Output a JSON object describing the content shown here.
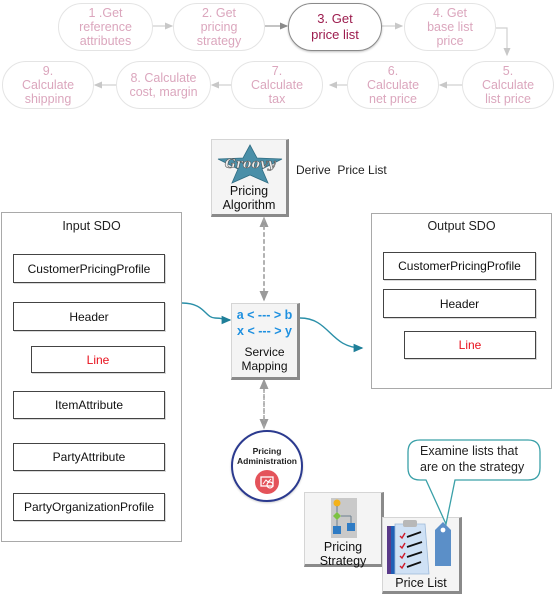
{
  "process_steps": [
    {
      "id": 1,
      "label": "1 .Get\nreference\nattributes",
      "active": false
    },
    {
      "id": 2,
      "label": "2. Get\npricing\nstrategy",
      "active": false
    },
    {
      "id": 3,
      "label": "3. Get\nprice list",
      "active": true
    },
    {
      "id": 4,
      "label": "4. Get\nbase list\nprice",
      "active": false
    },
    {
      "id": 5,
      "label": "5.\nCalculate\nlist price",
      "active": false
    },
    {
      "id": 6,
      "label": "6.\nCalculate\nnet price",
      "active": false
    },
    {
      "id": 7,
      "label": "7.\nCalculate\ntax",
      "active": false
    },
    {
      "id": 8,
      "label": "8. Calculate\ncost, margin",
      "active": false
    },
    {
      "id": 9,
      "label": "9.\nCalculate\nshipping",
      "active": false
    }
  ],
  "algorithm": {
    "icon": "groovy-star-icon",
    "label": "Pricing\nAlgorithm",
    "note": "Derive  Price List"
  },
  "input_sdo": {
    "title": "Input SDO",
    "fields": [
      "CustomerPricingProfile",
      "Header",
      "Line",
      "ItemAttribute",
      "PartyAttribute",
      "PartyOrganizationProfile"
    ]
  },
  "service_mapping": {
    "line1": "a < --- > b",
    "line2": "x < --- > y",
    "label": "Service\nMapping"
  },
  "output_sdo": {
    "title": "Output SDO",
    "fields": [
      "CustomerPricingProfile",
      "Header",
      "Line"
    ]
  },
  "pricing_admin": {
    "label": "Pricing\nAdministration",
    "icon": "pricing-admin-icon"
  },
  "pricing_strategy": {
    "label": "Pricing\nStrategy",
    "icon": "strategy-hierarchy-icon"
  },
  "price_list": {
    "label": "Price List",
    "icon": "price-list-clipboard-icon"
  },
  "callout": {
    "text": "Examine lists that\nare on the strategy"
  },
  "colors": {
    "step_text": "#dba6bd",
    "active_step_text": "#9c1c4e",
    "red_field": "#e8101c",
    "flow_arrow": "#2a8fa8",
    "admin_circle": "#2b3a8f",
    "admin_icon": "#e4535a",
    "mapping_text": "#1e90e0"
  }
}
